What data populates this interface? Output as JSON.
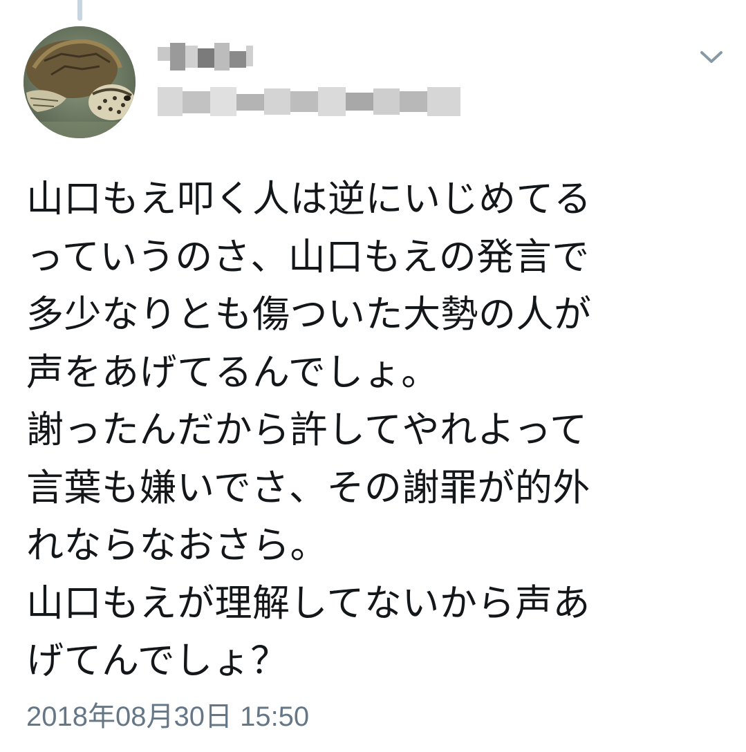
{
  "tweet": {
    "avatar_icon": "sea-turtle-avatar",
    "display_name_redacted": true,
    "handle_redacted": true,
    "menu_icon": "chevron-down-icon",
    "text_lines": [
      "山口もえ叩く人は逆にいじめてる",
      "っていうのさ、山口もえの発言で",
      "多少なりとも傷ついた大勢の人が",
      "声をあげてるんでしょ。",
      "謝ったんだから許してやれよって",
      "言葉も嫌いでさ、その謝罪が的外",
      "れならなおさら。",
      "山口もえが理解してないから声あ",
      "げてんでしょ？"
    ],
    "timestamp": "2018年08月30日 15:50"
  },
  "colors": {
    "text": "#14171a",
    "secondary_text": "#657786",
    "thread_line": "#c9d5de",
    "chevron": "#8899a6"
  }
}
